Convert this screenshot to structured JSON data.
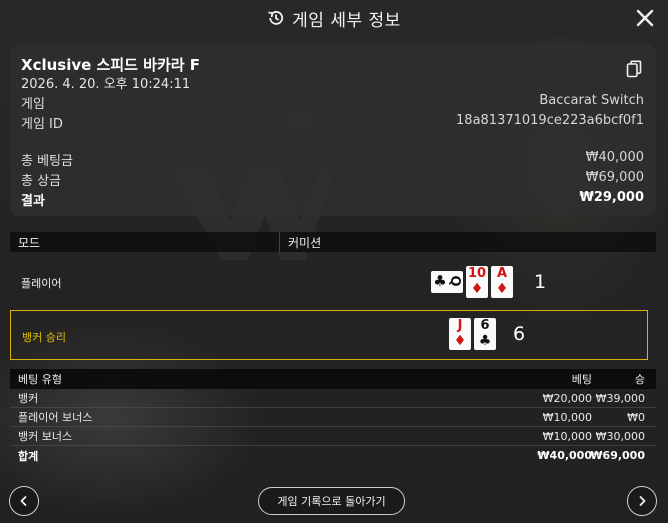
{
  "header": {
    "title": "게임 세부 정보",
    "icon": "history-icon",
    "close_icon": "close-icon"
  },
  "summary": {
    "title": "Xclusive 스피드 바카라 F",
    "datetime": "2026. 4. 20. 오후 10:24:11",
    "game_label": "게임",
    "game_value": "Baccarat Switch",
    "game_id_label": "게임 ID",
    "game_id_value": "18a81371019ce223a6bcf0f1",
    "total_bet_label": "총 베팅금",
    "total_bet_value": "₩40,000",
    "total_win_label": "총 상금",
    "total_win_value": "₩69,000",
    "result_label": "결과",
    "result_value": "₩29,000"
  },
  "mode_bar": {
    "mode": "모드",
    "commission": "커미션"
  },
  "player": {
    "label": "플레이어",
    "score": "1",
    "cards": [
      {
        "rank": "Q",
        "suit": "♣",
        "color": "#111111",
        "sideways": true
      },
      {
        "rank": "10",
        "suit": "♦",
        "color": "#d01414"
      },
      {
        "rank": "A",
        "suit": "♦",
        "color": "#d01414"
      }
    ]
  },
  "banker": {
    "label": "뱅커 승리",
    "score": "6",
    "highlight_color": "#d9b400",
    "cards": [
      {
        "rank": "J",
        "suit": "♦",
        "color": "#d01414"
      },
      {
        "rank": "6",
        "suit": "♣",
        "color": "#111111"
      }
    ]
  },
  "bets": {
    "headers": {
      "type": "베팅 유형",
      "bet": "베팅",
      "win": "승"
    },
    "rows": [
      {
        "type": "뱅커",
        "bet": "₩20,000",
        "win": "₩39,000"
      },
      {
        "type": "플레이어 보너스",
        "bet": "₩10,000",
        "win": "₩0"
      },
      {
        "type": "뱅커 보너스",
        "bet": "₩10,000",
        "win": "₩30,000"
      }
    ],
    "total": {
      "type": "합계",
      "bet": "₩40,000",
      "win": "₩69,000"
    }
  },
  "footer": {
    "back_label": "게임 기록으로 돌아가기",
    "prev_icon": "chevron-left-icon",
    "next_icon": "chevron-right-icon"
  }
}
